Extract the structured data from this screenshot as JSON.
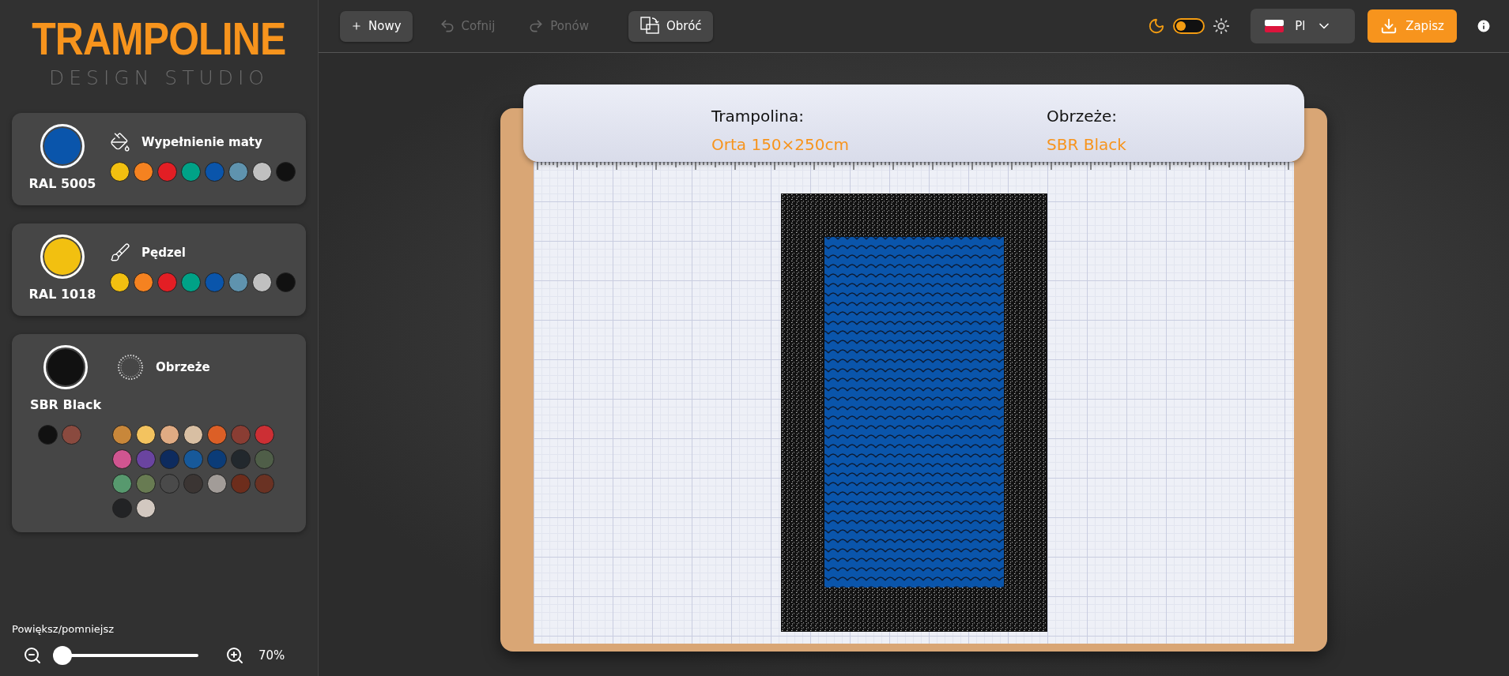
{
  "logo": {
    "title": "TRAMPOLINE",
    "subtitle": "DESIGN STUDIO"
  },
  "panels": [
    {
      "kind": "fill",
      "label": "Wypełnienie maty",
      "current": {
        "name": "RAL 5005",
        "color": "#0a55ab"
      },
      "swatches": [
        {
          "color": "#f2c010"
        },
        {
          "color": "#f58220"
        },
        {
          "color": "#e31e24"
        },
        {
          "color": "#00a287"
        },
        {
          "color": "#0a55ab"
        },
        {
          "color": "#5f93ae"
        },
        {
          "color": "#c0c0c0"
        },
        {
          "color": "#111111"
        }
      ]
    },
    {
      "kind": "brush",
      "label": "Pędzel",
      "current": {
        "name": "RAL 1018",
        "color": "#f2c010"
      },
      "swatches": [
        {
          "color": "#f2c010"
        },
        {
          "color": "#f58220"
        },
        {
          "color": "#e31e24"
        },
        {
          "color": "#00a287"
        },
        {
          "color": "#0a55ab"
        },
        {
          "color": "#5f93ae"
        },
        {
          "color": "#c0c0c0"
        },
        {
          "color": "#111111"
        }
      ]
    },
    {
      "kind": "border",
      "label": "Obrzeże",
      "current": {
        "name": "SBR Black",
        "color": "#111111"
      },
      "base_swatches": [
        {
          "color": "#111111"
        },
        {
          "color": "#8a4a3f"
        }
      ],
      "swatches": [
        {
          "color": "#c8873a"
        },
        {
          "color": "#f3c35f"
        },
        {
          "color": "#e0ab83"
        },
        {
          "color": "#d8bfa3"
        },
        {
          "color": "#dc5f26"
        },
        {
          "color": "#8a3d33"
        },
        {
          "color": "#cc2f34"
        },
        {
          "color": "#d05590"
        },
        {
          "color": "#6a44a0"
        },
        {
          "color": "#0d2b5e"
        },
        {
          "color": "#17599a"
        },
        {
          "color": "#0b3c78"
        },
        {
          "color": "#22282d"
        },
        {
          "color": "#4f5e48"
        },
        {
          "color": "#57996e"
        },
        {
          "color": "#687b52"
        },
        {
          "color": "#4a4a4a"
        },
        {
          "color": "#3b3533"
        },
        {
          "color": "#a29c98"
        },
        {
          "color": "#6d2d1c"
        },
        {
          "color": "#6a3223"
        },
        {
          "color": "#222325"
        },
        {
          "color": "#d2c8c0"
        }
      ]
    }
  ],
  "zoom": {
    "label": "Powiększ/pomniejsz",
    "level": 0,
    "reading": "70%"
  },
  "toolbar": {
    "buttons": [
      {
        "kind": "new",
        "label": "Nowy",
        "disabled": false
      },
      {
        "kind": "undo",
        "label": "Cofnij",
        "disabled": true
      },
      {
        "kind": "redo",
        "label": "Ponów",
        "disabled": true
      },
      {
        "kind": "rotate",
        "label": "Obróć",
        "disabled": false
      }
    ],
    "theme_toggle": {
      "on": false
    },
    "language": "Pl",
    "save": "Zapisz"
  },
  "sheet": {
    "fields": [
      {
        "label": "Trampolina:",
        "value": "Orta 150×250cm"
      },
      {
        "label": "Obrzeże:",
        "value": "SBR Black"
      }
    ]
  }
}
